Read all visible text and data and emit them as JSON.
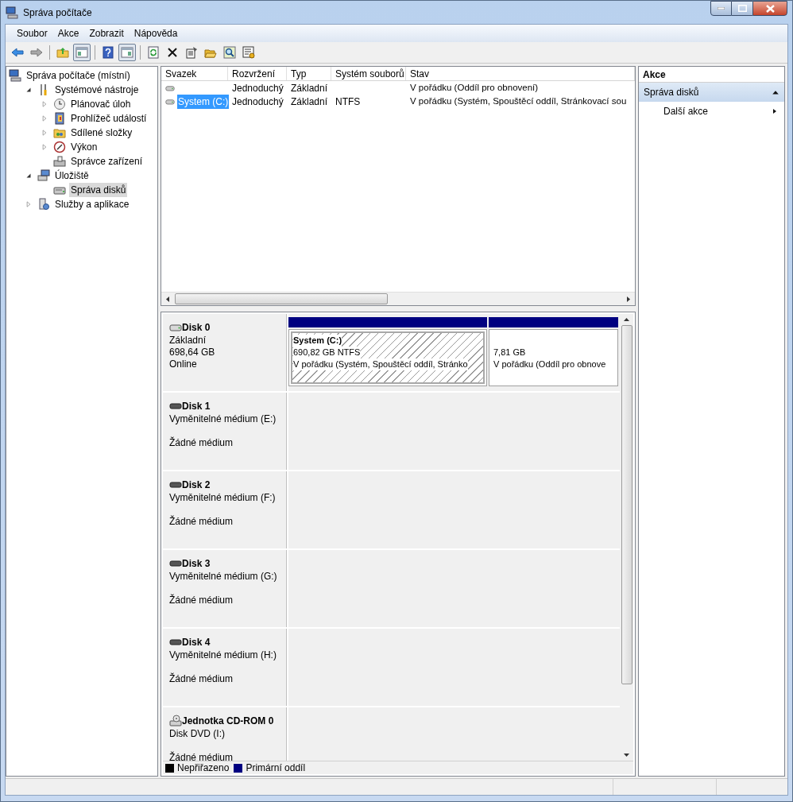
{
  "window": {
    "title": "Správa počítače"
  },
  "menu": [
    "Soubor",
    "Akce",
    "Zobrazit",
    "Nápověda"
  ],
  "toolbar": [
    {
      "kind": "back",
      "pressed": false
    },
    {
      "kind": "forward",
      "pressed": false
    },
    {
      "kind": "up",
      "pressed": false
    },
    {
      "kind": "tree",
      "pressed": true
    },
    {
      "kind": "help",
      "pressed": false
    },
    {
      "kind": "pane",
      "pressed": true
    },
    {
      "kind": "refresh",
      "pressed": false
    },
    {
      "kind": "delete",
      "pressed": false
    },
    {
      "kind": "properties",
      "pressed": false
    },
    {
      "kind": "open",
      "pressed": false
    },
    {
      "kind": "find",
      "pressed": false
    },
    {
      "kind": "settings",
      "pressed": false
    }
  ],
  "tree": [
    {
      "label": "Správa počítače (místní)",
      "kind": "computer",
      "selected": false,
      "children": [
        {
          "label": "Systémové nástroje",
          "kind": "tools",
          "expanded": true,
          "selected": false,
          "children": [
            {
              "label": "Plánovač úloh",
              "kind": "clock",
              "expanded": false,
              "selected": false
            },
            {
              "label": "Prohlížeč událostí",
              "kind": "events",
              "expanded": false,
              "selected": false
            },
            {
              "label": "Sdílené složky",
              "kind": "shared",
              "expanded": false,
              "selected": false
            },
            {
              "label": "Výkon",
              "kind": "performance",
              "expanded": false,
              "selected": false
            },
            {
              "label": "Správce zařízení",
              "kind": "devices",
              "selected": false
            }
          ]
        },
        {
          "label": "Úložiště",
          "kind": "storage",
          "expanded": true,
          "selected": false,
          "children": [
            {
              "label": "Správa disků",
              "kind": "disk",
              "selected": true
            }
          ]
        },
        {
          "label": "Služby a aplikace",
          "kind": "services",
          "expanded": false,
          "selected": false
        }
      ]
    }
  ],
  "volumes": {
    "columns": [
      "Svazek",
      "Rozvržení",
      "Typ",
      "Systém souborů",
      "Stav"
    ],
    "rows": [
      {
        "layout": "Jednoduchý",
        "type": "Základní",
        "status": "V pořádku (Oddíl pro obnovení)",
        "selected": false
      },
      {
        "volume": "System (C:)",
        "layout": "Jednoduchý",
        "type": "Základní",
        "file_system": "NTFS",
        "status": "V pořádku (Systém, Spouštěcí oddíl, Stránkovací sou",
        "selected": true
      }
    ]
  },
  "disks": [
    {
      "name": "Disk 0",
      "kind": "fixed",
      "info": [
        "Základní",
        "698,64 GB"
      ],
      "status": "Online",
      "partitions": [
        {
          "label": "System  (C:)",
          "size": "690,82 GB NTFS",
          "status": "V pořádku (Systém, Spouštěcí oddíl, Stránko",
          "selected": true
        },
        {
          "size": "7,81 GB",
          "status": "V pořádku (Oddíl pro obnove",
          "selected": false
        }
      ]
    },
    {
      "name": "Disk 1",
      "kind": "removable",
      "info": [
        "Vyměnitelné médium (E:)"
      ],
      "status": "Žádné médium"
    },
    {
      "name": "Disk 2",
      "kind": "removable",
      "info": [
        "Vyměnitelné médium (F:)"
      ],
      "status": "Žádné médium"
    },
    {
      "name": "Disk 3",
      "kind": "removable",
      "info": [
        "Vyměnitelné médium (G:)"
      ],
      "status": "Žádné médium"
    },
    {
      "name": "Disk 4",
      "kind": "removable",
      "info": [
        "Vyměnitelné médium (H:)"
      ],
      "status": "Žádné médium"
    },
    {
      "name": "Jednotka CD-ROM 0",
      "kind": "cdrom",
      "info": [
        "Disk DVD (I:)"
      ],
      "status": "Žádné médium"
    }
  ],
  "legend": [
    {
      "label": "Nepřiřazeno",
      "color": "#000000"
    },
    {
      "label": "Primární oddíl",
      "color": "#000080"
    }
  ],
  "actions": {
    "title": "Akce",
    "sections": [
      {
        "label": "Správa disků",
        "expanded": true,
        "items": [
          {
            "label": "Další akce",
            "submenu": true
          }
        ]
      }
    ]
  }
}
